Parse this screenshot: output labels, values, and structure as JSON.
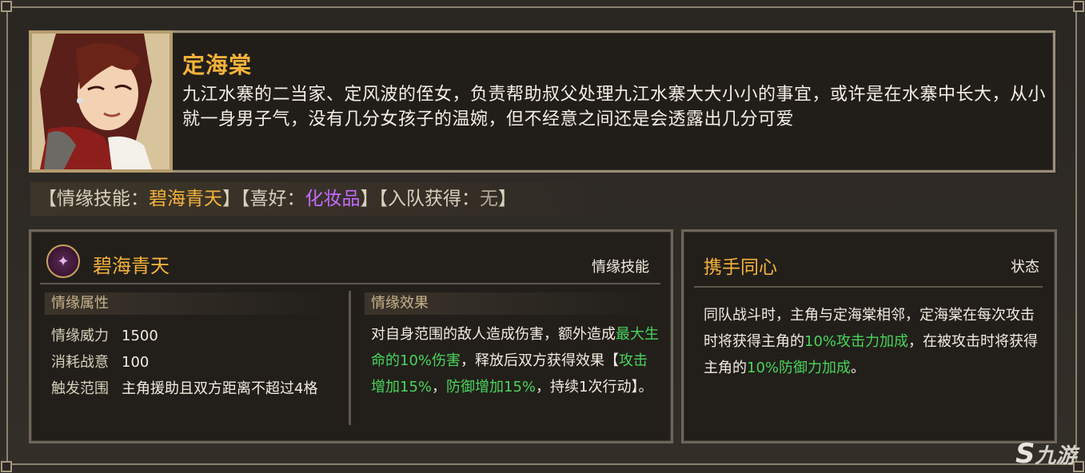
{
  "character": {
    "name": "定海棠",
    "bio": "九江水寨的二当家、定风波的侄女，负责帮助叔父处理九江水寨大大小小的事宜，或许是在水寨中长大，从小就一身男子气，没有几分女孩子的温婉，但不经意之间还是会透露出几分可爱"
  },
  "info_bar": {
    "skill_open": "【情缘技能：",
    "skill_value": "碧海青天",
    "skill_close": "】",
    "hobby_open": "【喜好：",
    "hobby_value": "化妆品",
    "hobby_close": "】",
    "join_open": "【入队获得：",
    "join_value": "无",
    "join_close": "】"
  },
  "skill": {
    "name": "碧海青天",
    "type": "情缘技能",
    "icon": "crystal-flower-icon",
    "attr_header": "情缘属性",
    "effect_header": "情缘效果",
    "attrs": [
      {
        "key": "情缘威力",
        "value": "1500"
      },
      {
        "key": "消耗战意",
        "value": "100"
      },
      {
        "key": "触发范围",
        "value": "主角援助且双方距离不超过4格"
      }
    ],
    "effect": {
      "p1": "对自身范围的敌人造成伤害，额外造成",
      "g1": "最大生命的10%伤害",
      "p2": "，释放后双方获得效果【",
      "g2": "攻击增加15%",
      "p3": "，",
      "g3": "防御增加15%",
      "p4": "，持续1次行动】。"
    }
  },
  "status": {
    "name": "携手同心",
    "type": "状态",
    "text": {
      "p1": "同队战斗时，主角与定海棠相邻，定海棠在每次攻击时将获得主角的",
      "g1": "10%攻击力加成",
      "p2": "，在被攻击时将获得主角的",
      "g2": "10%防御力加成",
      "p3": "。"
    }
  },
  "watermark": {
    "glyph": "S",
    "text": "九游"
  },
  "colors": {
    "accent_gold": "#f5b23a",
    "hobby_purple": "#c46bff",
    "bonus_green": "#49d45a"
  }
}
